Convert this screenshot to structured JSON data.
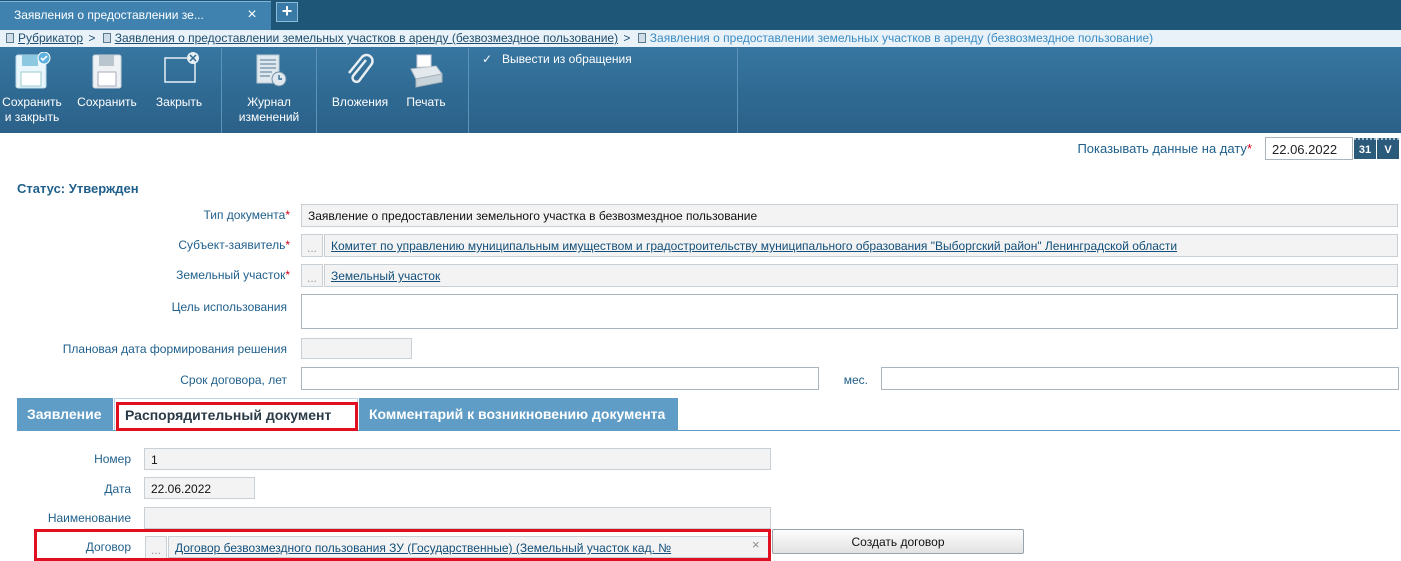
{
  "tab": {
    "title": "Заявления о предоставлении зе...",
    "close_glyph": "×",
    "add_glyph": "+"
  },
  "breadcrumb": {
    "root": "Рубрикатор",
    "level1": "Заявления о предоставлении земельных участков в аренду (безвозмездное пользование)",
    "current": "Заявления о предоставлении земельных участков в аренду (безвозмездное пользование)",
    "separator": ">"
  },
  "toolbar": {
    "save_close_line1": "Сохранить",
    "save_close_line2": "и закрыть",
    "save": "Сохранить",
    "close": "Закрыть",
    "journal_line1": "Журнал",
    "journal_line2": "изменений",
    "attachments": "Вложения",
    "print": "Печать",
    "withdraw": "Вывести из обращения"
  },
  "date_filter": {
    "label": "Показывать данные на дату",
    "value": "22.06.2022",
    "calendar_label": "31",
    "dropdown_label": "V"
  },
  "status": "Статус: Утвержден",
  "form": {
    "doc_type_label": "Тип документа",
    "doc_type_value": "Заявление о предоставлении земельного участка в безвозмездное пользование",
    "applicant_label": "Субъект-заявитель",
    "applicant_value": "Комитет по управлению муниципальным имуществом и градостроительству муниципального образования \"Выборгский район\" Ленинградской области",
    "parcel_label": "Земельный участок",
    "parcel_value": "Земельный участок",
    "purpose_label": "Цель использования",
    "purpose_value": "",
    "planned_date_label": "Плановая дата формирования решения",
    "planned_date_value": "",
    "term_label": "Срок договора, лет",
    "term_years_value": "",
    "months_label": "мес.",
    "term_months_value": "",
    "dots": "...",
    "required_mark": "*"
  },
  "inner_tabs": [
    "Заявление",
    "Распорядительный документ",
    "Комментарий к возникновению документа"
  ],
  "admin_doc": {
    "number_label": "Номер",
    "number_value": "1",
    "date_label": "Дата",
    "date_value": "22.06.2022",
    "name_label": "Наименование",
    "name_value": "",
    "contract_label": "Договор",
    "contract_value": "Договор безвозмездного пользования ЗУ (Государственные) (Земельный участок кад. №",
    "clear_glyph": "×",
    "create_button": "Создать договор"
  },
  "colors": {
    "header_bg": "#1d5677",
    "ribbon_bg": "#2f6a93",
    "label_blue": "#1f5f8b",
    "highlight_red": "#e01020",
    "tab_blue": "#5f9cc6"
  }
}
